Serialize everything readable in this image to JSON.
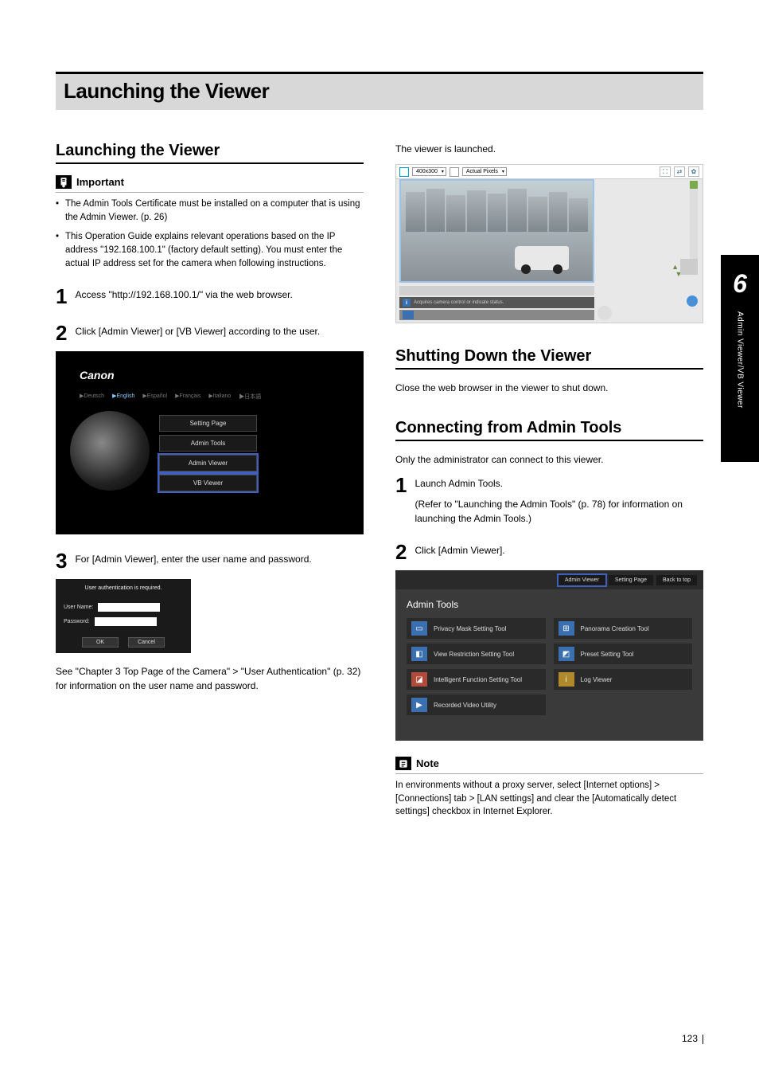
{
  "chapter": {
    "number": "6",
    "side_label": "Admin Viewer/VB Viewer"
  },
  "page_title": "Launching the Viewer",
  "left": {
    "h2": "Launching the Viewer",
    "important_label": "Important",
    "important_bullets": [
      "The Admin Tools Certificate must be installed on a computer that is using the Admin Viewer. (p. 26)",
      "This Operation Guide explains relevant operations based on the IP address \"192.168.100.1\" (factory default setting). You must enter the actual IP address set for the camera when following instructions."
    ],
    "step1_num": "1",
    "step1_text": "Access \"http://192.168.100.1/\" via the web browser.",
    "step2_num": "2",
    "step2_text": "Click [Admin Viewer] or [VB Viewer] according to the user.",
    "fig_top": {
      "logo": "Canon",
      "langs": [
        "▶Deutsch",
        "▶English",
        "▶Español",
        "▶Français",
        "▶Italiano",
        "▶日本語"
      ],
      "btn_setting": "Setting Page",
      "btn_admintools": "Admin Tools",
      "btn_adminviewer": "Admin Viewer",
      "btn_vbviewer": "VB Viewer"
    },
    "step3_num": "3",
    "step3_text": "For [Admin Viewer], enter the user name and password.",
    "fig_auth": {
      "title": "User authentication is required.",
      "user": "User Name:",
      "pass": "Password:",
      "ok": "OK",
      "cancel": "Cancel"
    },
    "after_auth": "See \"Chapter 3 Top Page of the Camera\" > \"User Authentication\" (p. 32) for information on the user name and password."
  },
  "right": {
    "launched": "The viewer is launched.",
    "fig_viewer": {
      "scale_label": "400x300",
      "fit_label": "Actual Pixels",
      "info": "Acquires camera control or indicate status."
    },
    "h2_shut": "Shutting Down the Viewer",
    "shut_text": "Close the web browser in the viewer to shut down.",
    "h2_conn": "Connecting from Admin Tools",
    "conn_intro": "Only the administrator can connect to this viewer.",
    "cstep1_num": "1",
    "cstep1_text": "Launch Admin Tools.",
    "cstep1_sub": "(Refer to \"Launching the Admin Tools\" (p. 78) for information on launching the Admin Tools.)",
    "cstep2_num": "2",
    "cstep2_text": "Click [Admin Viewer].",
    "fig_at": {
      "tab_viewer": "Admin Viewer",
      "tab_setting": "Setting Page",
      "tab_back": "Back to top",
      "title": "Admin Tools",
      "items": [
        "Privacy Mask Setting Tool",
        "Panorama Creation Tool",
        "View Restriction Setting Tool",
        "Preset Setting Tool",
        "Intelligent Function Setting Tool",
        "Log Viewer",
        "Recorded Video Utility"
      ]
    },
    "note_label": "Note",
    "note_text": "In environments without a proxy server, select [Internet options] > [Connections] tab > [LAN settings] and clear the [Automatically detect settings] checkbox in Internet Explorer."
  },
  "page_number": "123"
}
